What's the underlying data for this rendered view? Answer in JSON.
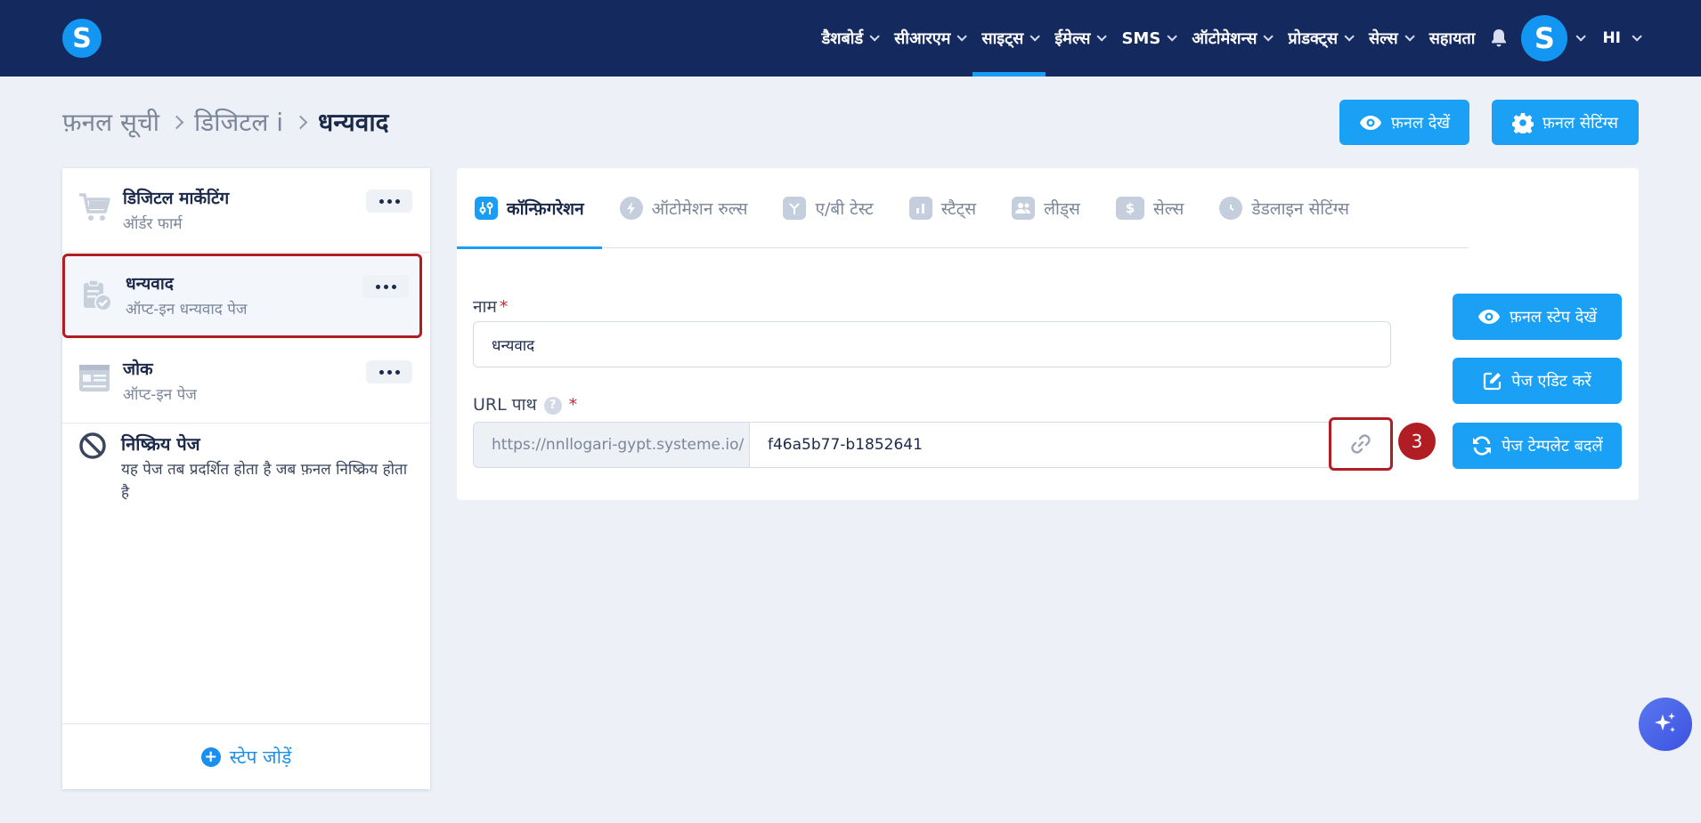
{
  "header": {
    "logo_letter": "S",
    "nav": [
      {
        "label": "डैशबोर्ड",
        "has_dropdown": true
      },
      {
        "label": "सीआरएम",
        "has_dropdown": true
      },
      {
        "label": "साइट्स",
        "has_dropdown": true,
        "active": true
      },
      {
        "label": "ईमेल्स",
        "has_dropdown": true
      },
      {
        "label": "SMS",
        "has_dropdown": true
      },
      {
        "label": "ऑटोमेशन्स",
        "has_dropdown": true
      },
      {
        "label": "प्रोडक्ट्स",
        "has_dropdown": true
      },
      {
        "label": "सेल्स",
        "has_dropdown": true
      },
      {
        "label": "सहायता",
        "has_dropdown": false
      }
    ],
    "avatar_letter": "S",
    "language": "HI"
  },
  "breadcrumb": [
    "फ़नल सूची",
    "डिजिटल i",
    "धन्यवाद"
  ],
  "actions": {
    "view_funnel": "फ़नल देखें",
    "funnel_settings": "फ़नल सेटिंग्स"
  },
  "steps": [
    {
      "title": "डिजिटल मार्केटिंग",
      "subtitle": "ऑर्डर फार्म",
      "icon": "cart-icon"
    },
    {
      "title": "धन्यवाद",
      "subtitle": "ऑप्ट-इन धन्यवाद पेज",
      "icon": "clipboard-check-icon",
      "selected": true
    },
    {
      "title": "जोक",
      "subtitle": "ऑप्ट-इन पेज",
      "icon": "form-page-icon"
    }
  ],
  "inactive_page": {
    "title": "निष्क्रिय पेज",
    "description": "यह पेज तब प्रदर्शित होता है जब फ़नल निष्क्रिय होता है"
  },
  "add_step": "स्टेप जोड़ें",
  "tabs": [
    {
      "label": "कॉन्फ़िगरेशन",
      "icon": "sliders-icon",
      "active": true
    },
    {
      "label": "ऑटोमेशन रुल्स",
      "icon": "bolt-icon"
    },
    {
      "label": "ए/बी टेस्ट",
      "icon": "split-icon"
    },
    {
      "label": "स्टैट्स",
      "icon": "bar-chart-icon"
    },
    {
      "label": "लीड्स",
      "icon": "users-icon"
    },
    {
      "label": "सेल्स",
      "icon": "dollar-icon"
    },
    {
      "label": "डेडलाइन सेटिंग्स",
      "icon": "clock-icon"
    }
  ],
  "form": {
    "name_label": "नाम",
    "name_value": "धन्यवाद",
    "url_label": "URL पाथ",
    "url_prefix": "https://nnllogari-gypt.systeme.io/",
    "url_slug": "f46a5b77-b1852641",
    "help_mark": "?",
    "required_mark": "*"
  },
  "side_actions": {
    "view_step": "फ़नल स्टेप देखें",
    "edit_page": "पेज एडिट करें",
    "change_template": "पेज टेम्पलेट बदलें"
  },
  "annotation_badge": "3",
  "colors": {
    "topbar": "#14295e",
    "accent": "#1aa0f5",
    "highlight": "#b01e23"
  }
}
